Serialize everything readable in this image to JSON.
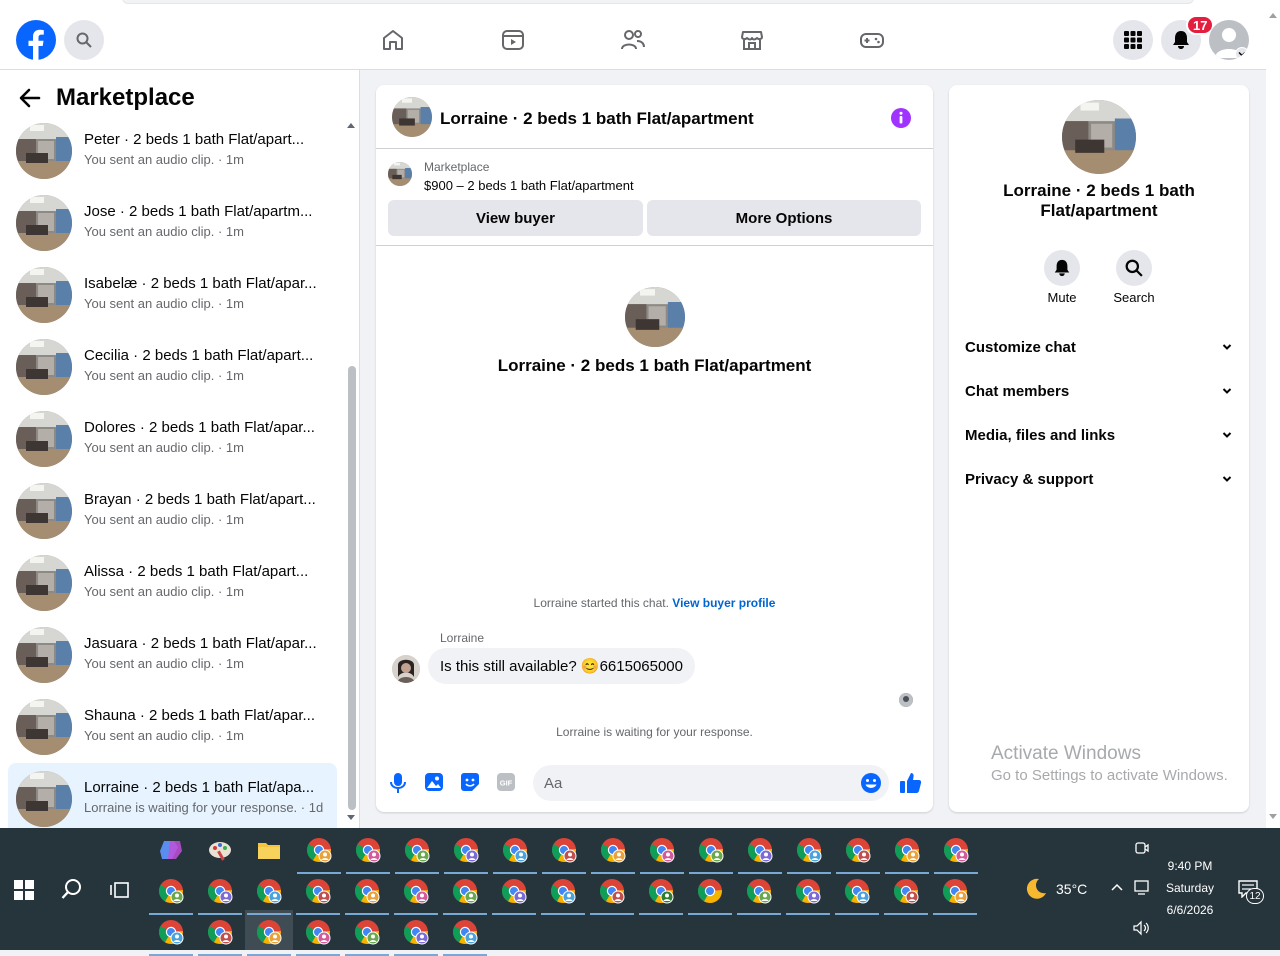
{
  "header": {
    "notification_count": "17",
    "nav_icons": [
      "home-icon",
      "video-icon",
      "friends-icon",
      "marketplace-icon",
      "gaming-icon"
    ]
  },
  "sidebar": {
    "title": "Marketplace",
    "conversations": [
      {
        "name": "Peter · 2 beds 1 bath Flat/apart...",
        "preview": "You sent an audio clip.",
        "time": "1m",
        "active": false
      },
      {
        "name": "Jose · 2 beds 1 bath Flat/apartm...",
        "preview": "You sent an audio clip.",
        "time": "1m",
        "active": false
      },
      {
        "name": "Isabelæ · 2 beds 1 bath Flat/apar...",
        "preview": "You sent an audio clip.",
        "time": "1m",
        "active": false
      },
      {
        "name": "Cecilia · 2 beds 1 bath Flat/apart...",
        "preview": "You sent an audio clip.",
        "time": "1m",
        "active": false
      },
      {
        "name": "Dolores · 2 beds 1 bath Flat/apar...",
        "preview": "You sent an audio clip.",
        "time": "1m",
        "active": false
      },
      {
        "name": "Brayan · 2 beds 1 bath Flat/apart...",
        "preview": "You sent an audio clip.",
        "time": "1m",
        "active": false
      },
      {
        "name": "Alissa · 2 beds 1 bath Flat/apart...",
        "preview": "You sent an audio clip.",
        "time": "1m",
        "active": false
      },
      {
        "name": "Jasuara · 2 beds 1 bath Flat/apar...",
        "preview": "You sent an audio clip.",
        "time": "1m",
        "active": false
      },
      {
        "name": "Shauna · 2 beds 1 bath Flat/apar...",
        "preview": "You sent an audio clip.",
        "time": "1m",
        "active": false
      },
      {
        "name": "Lorraine · 2 beds 1 bath Flat/apa...",
        "preview": "Lorraine is waiting for your response.",
        "time": "1d",
        "active": true
      }
    ]
  },
  "chat": {
    "title": "Lorraine · 2 beds 1 bath Flat/apartment",
    "listing_source": "Marketplace",
    "listing_detail": "$900 – 2 beds 1 bath Flat/apartment",
    "view_buyer_label": "View buyer",
    "more_options_label": "More Options",
    "intro_name": "Lorraine · 2 beds 1 bath Flat/apartment",
    "started_text": "Lorraine started this chat.",
    "view_buyer_profile_label": "View buyer profile",
    "sender_name": "Lorraine",
    "message_text": "Is this still available? 😊6615065000",
    "waiting_text": "Lorraine is waiting for your response.",
    "composer_placeholder": "Aa"
  },
  "info_panel": {
    "title": "Lorraine · 2 beds 1 bath Flat/apartment",
    "mute_label": "Mute",
    "search_label": "Search",
    "sections": [
      "Customize chat",
      "Chat members",
      "Media, files and links",
      "Privacy & support"
    ]
  },
  "watermark": {
    "line1": "Activate Windows",
    "line2": "Go to Settings to activate Windows."
  },
  "taskbar": {
    "temperature": "35°C",
    "time": "9:40 PM",
    "day": "Saturday",
    "date": "6/6/2026",
    "notification_count": "12"
  },
  "colors": {
    "brand_blue": "#0866ff",
    "accent_purple": "#a033ff",
    "link_blue": "#0064d1",
    "badge_red": "#e41e3f"
  }
}
